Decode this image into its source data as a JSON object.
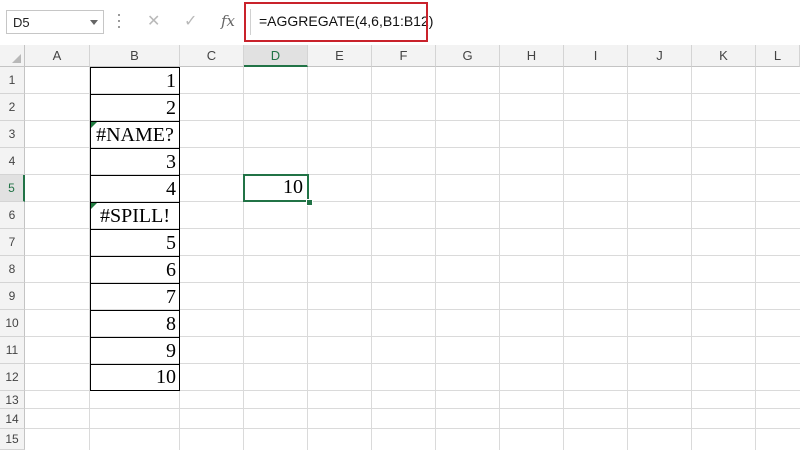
{
  "formula_bar": {
    "name_box": "D5",
    "cancel_icon": "✕",
    "enter_icon": "✓",
    "fx_label": "fx",
    "formula": "=AGGREGATE(4,6,B1:B12)"
  },
  "columns": [
    "A",
    "B",
    "C",
    "D",
    "E",
    "F",
    "G",
    "H",
    "I",
    "J",
    "K",
    "L"
  ],
  "rows": [
    "1",
    "2",
    "3",
    "4",
    "5",
    "6",
    "7",
    "8",
    "9",
    "10",
    "11",
    "12",
    "13",
    "14",
    "15"
  ],
  "cells": {
    "B1": "1",
    "B2": "2",
    "B3": "#NAME?",
    "B4": "3",
    "B5": "4",
    "B6": "#SPILL!",
    "B7": "5",
    "B8": "6",
    "B9": "7",
    "B10": "8",
    "B11": "9",
    "B12": "10",
    "D5": "10"
  },
  "selected_cell": "D5",
  "selected_column": "D",
  "selected_row": "5",
  "colors": {
    "selection": "#217346",
    "highlight_box": "#c9222b",
    "error_indicator": "#1e7a3e"
  }
}
